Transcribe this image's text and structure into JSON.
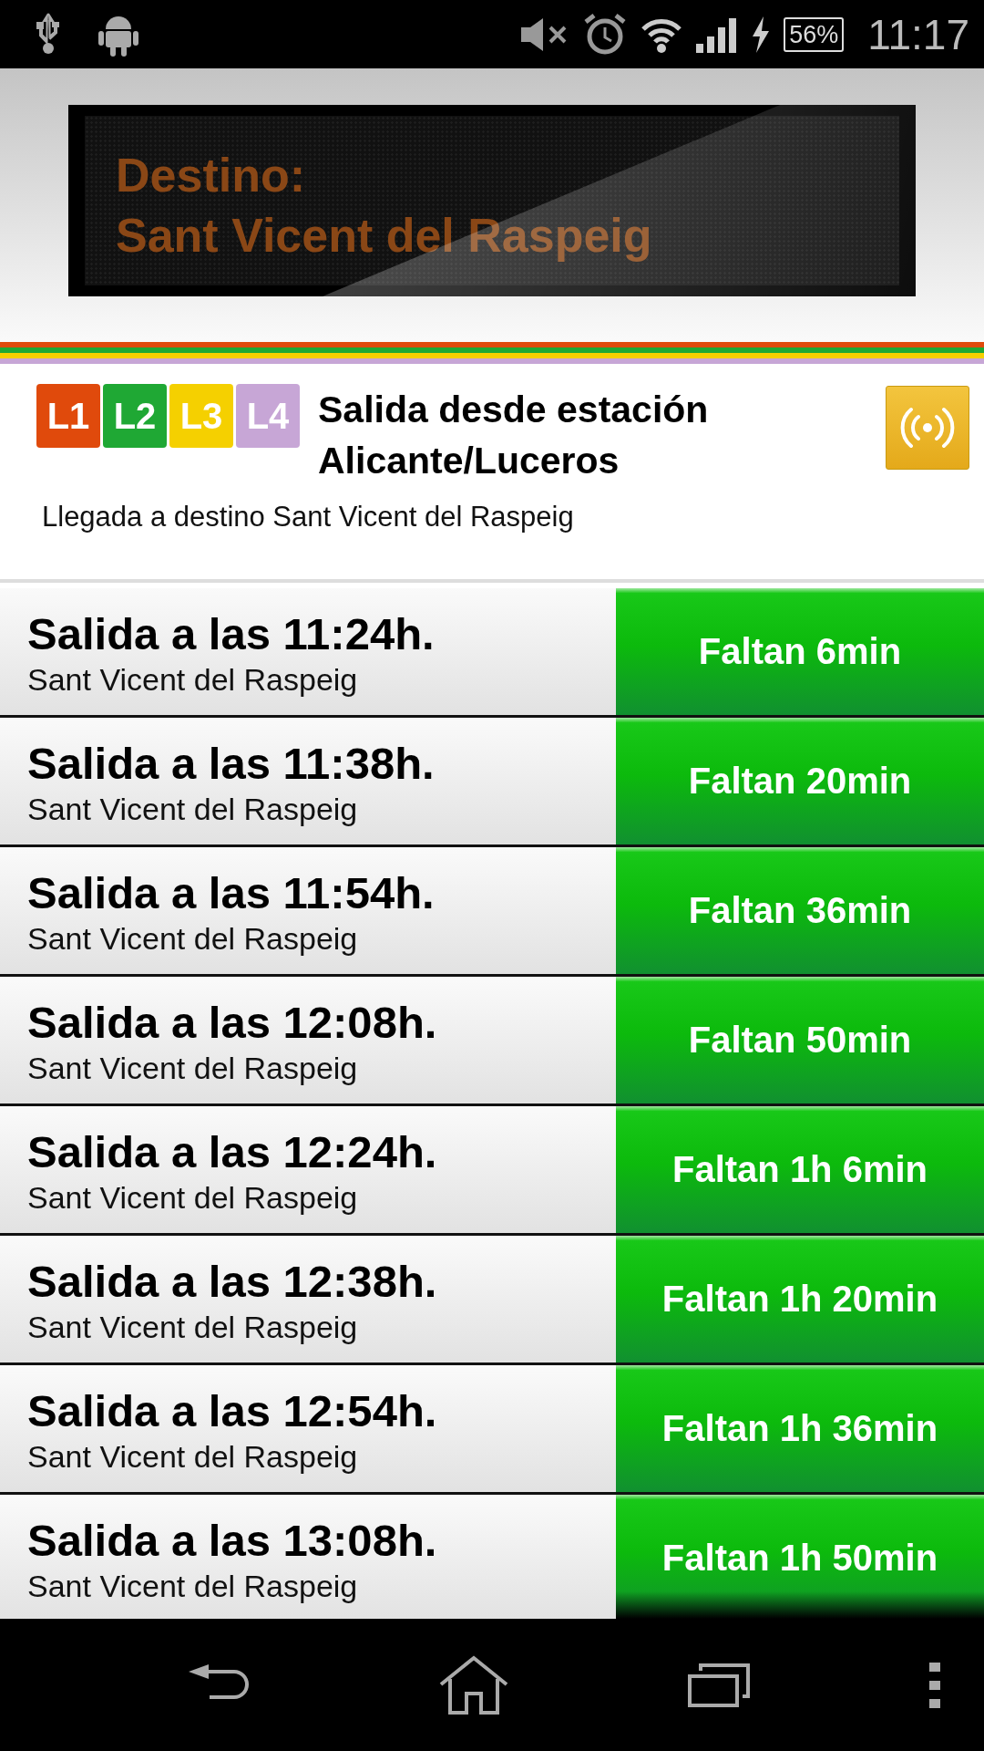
{
  "status_bar": {
    "battery": "56%",
    "time": "11:17"
  },
  "destination_board": {
    "label": "Destino:",
    "destination": "Sant Vicent del Raspeig"
  },
  "lines": [
    {
      "label": "L1",
      "color": "#e04a0c"
    },
    {
      "label": "L2",
      "color": "#1fa834"
    },
    {
      "label": "L3",
      "color": "#f5d000"
    },
    {
      "label": "L4",
      "color": "#c7a6d6"
    }
  ],
  "station": {
    "title": "Salida desde estación Alicante/Luceros",
    "subtitle": "Llegada a destino Sant Vicent del Raspeig"
  },
  "departures": [
    {
      "time": "Salida a las 11:24h.",
      "destination": "Sant Vicent del Raspeig",
      "remaining": "Faltan 6min"
    },
    {
      "time": "Salida a las 11:38h.",
      "destination": "Sant Vicent del Raspeig",
      "remaining": "Faltan 20min"
    },
    {
      "time": "Salida a las 11:54h.",
      "destination": "Sant Vicent del Raspeig",
      "remaining": "Faltan 36min"
    },
    {
      "time": "Salida a las 12:08h.",
      "destination": "Sant Vicent del Raspeig",
      "remaining": "Faltan 50min"
    },
    {
      "time": "Salida a las 12:24h.",
      "destination": "Sant Vicent del Raspeig",
      "remaining": "Faltan 1h 6min"
    },
    {
      "time": "Salida a las 12:38h.",
      "destination": "Sant Vicent del Raspeig",
      "remaining": "Faltan 1h 20min"
    },
    {
      "time": "Salida a las 12:54h.",
      "destination": "Sant Vicent del Raspeig",
      "remaining": "Faltan 1h 36min"
    },
    {
      "time": "Salida a las 13:08h.",
      "destination": "Sant Vicent del Raspeig",
      "remaining": "Faltan 1h 50min"
    }
  ]
}
